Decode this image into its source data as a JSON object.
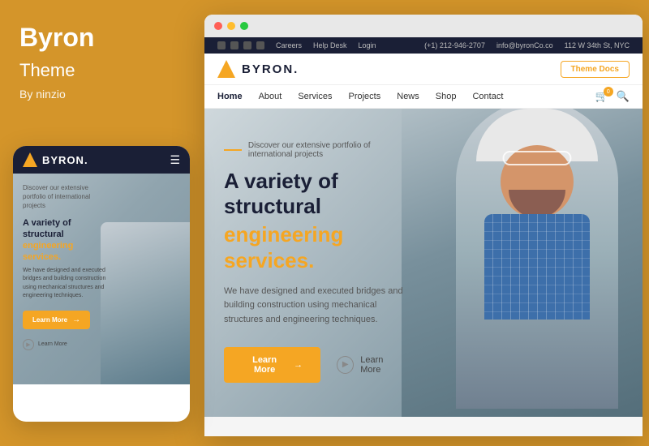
{
  "background_color": "#D4952A",
  "left_panel": {
    "title": "Byron",
    "subtitle": "Theme",
    "by": "By ninzio"
  },
  "mobile_mockup": {
    "logo_text": "BYRON.",
    "hero": {
      "tagline": "Discover our extensive portfolio of international projects",
      "h1_line1": "A variety of structural",
      "h1_line2": "engineering services.",
      "desc": "We have designed and executed bridges and building construction using mechanical structures and engineering techniques.",
      "btn_primary": "Learn More",
      "btn_secondary": "Learn More"
    }
  },
  "desktop_mockup": {
    "infobar": {
      "phone": "(+1) 212-946-2707",
      "email": "info@byronCo.co",
      "address": "112 W 34th St, NYC",
      "links": [
        "Careers",
        "Help Desk",
        "Login"
      ]
    },
    "navbar": {
      "logo_text": "BYRON.",
      "theme_docs_btn": "Theme Docs"
    },
    "nav_menu": {
      "items": [
        "Home",
        "About",
        "Services",
        "Projects",
        "News",
        "Shop",
        "Contact"
      ]
    },
    "hero": {
      "tagline": "Discover our extensive portfolio of international projects",
      "h1_line1": "A variety of structural",
      "h1_orange": "engineering services.",
      "desc": "We have designed and executed bridges and building construction using mechanical structures and engineering techniques.",
      "btn_primary": "Learn More",
      "btn_secondary": "Learn More"
    }
  }
}
